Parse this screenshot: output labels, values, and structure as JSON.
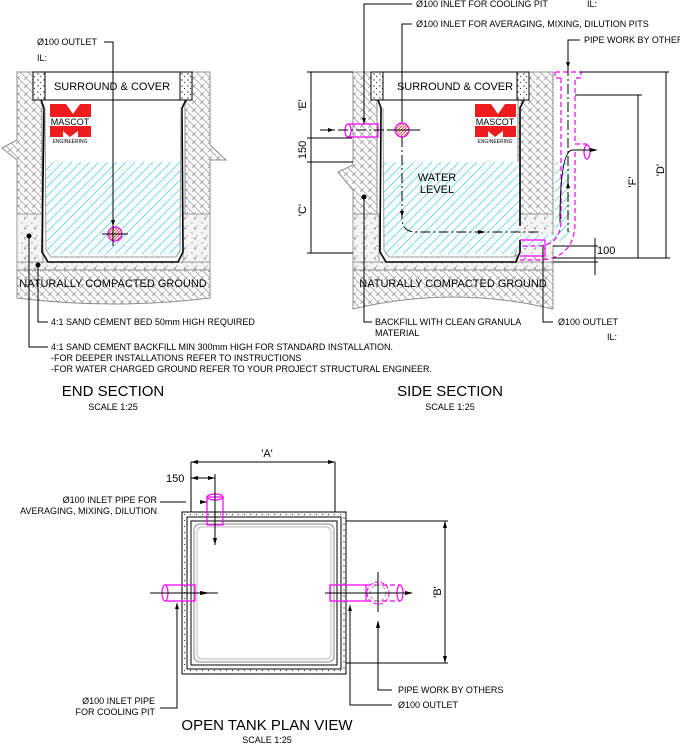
{
  "brand": {
    "name": "MASCOT",
    "subtitle": "ENGINEERING",
    "color": "#ee1c1c"
  },
  "colors": {
    "water_hatch": "#58d3f0",
    "pipe": "#ff00ff",
    "ground": "#8c8c8c"
  },
  "end_section": {
    "title": "END SECTION",
    "scale": "SCALE 1:25",
    "outlet_label": "Ø100 OUTLET",
    "il_label": "IL:",
    "cover_label": "SURROUND & COVER",
    "ground_label": "NATURALLY COMPACTED GROUND",
    "note_bed": "4:1 SAND CEMENT BED 50mm HIGH REQUIRED",
    "note_backfill": [
      "4:1 SAND CEMENT BACKFILL MIN 300mm HIGH FOR STANDARD INSTALLATION.",
      "-FOR DEEPER INSTALLATIONS REFER TO INSTRUCTIONS",
      "-FOR WATER CHARGED GROUND REFER TO YOUR PROJECT STRUCTURAL ENGINEER."
    ]
  },
  "side_section": {
    "title": "SIDE SECTION",
    "scale": "SCALE 1:25",
    "inlet_cooling": "Ø100 INLET FOR COOLING PIT",
    "il_top": "IL:",
    "inlet_averaging": "Ø100 INLET FOR AVERAGING, MIXING, DILUTION PITS",
    "pipe_work": "PIPE WORK BY OTHERS",
    "cover_label": "SURROUND & COVER",
    "water_level": [
      "WATER",
      "LEVEL"
    ],
    "ground_label": "NATURALLY COMPACTED GROUND",
    "backfill_note": [
      "BACKFILL WITH CLEAN GRANULA",
      "MATERIAL"
    ],
    "outlet_label": "Ø100 OUTLET",
    "il_bottom": "IL:",
    "dims": {
      "e": "'E'",
      "d150": "150",
      "c": "'C'",
      "d": "'D'",
      "f": "'F'",
      "d100": "100"
    }
  },
  "plan_view": {
    "title": "OPEN TANK PLAN VIEW",
    "scale": "SCALE 1:25",
    "dim_a": "'A'",
    "dim_b": "'B'",
    "dim_150": "150",
    "inlet_averaging": [
      "Ø100 INLET PIPE FOR",
      "AVERAGING, MIXING, DILUTION"
    ],
    "inlet_cooling": [
      "Ø100 INLET PIPE",
      "FOR COOLING PIT"
    ],
    "pipe_work": "PIPE WORK BY OTHERS",
    "outlet_label": "Ø100 OUTLET"
  }
}
